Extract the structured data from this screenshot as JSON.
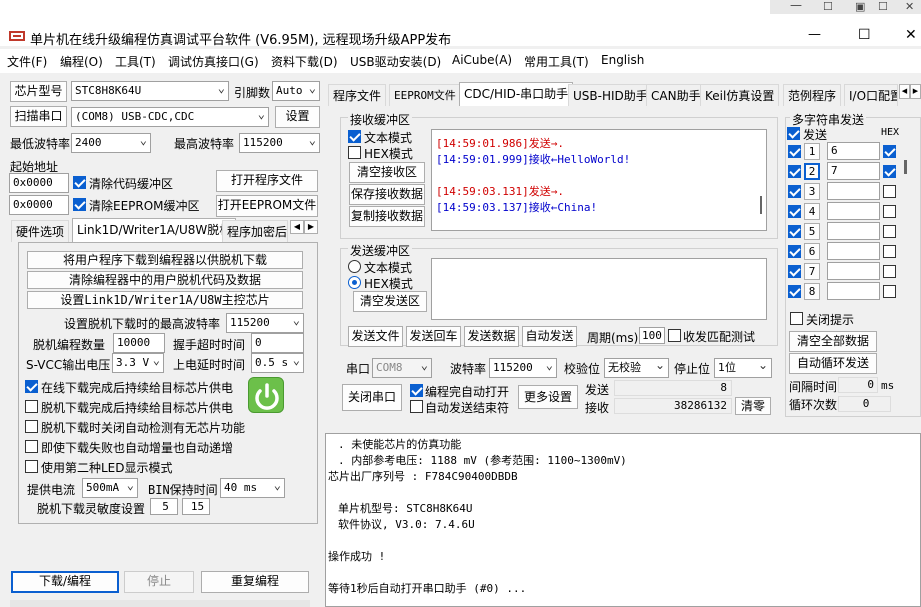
{
  "title": "单片机在线升级编程仿真调试平台软件 (V6.95M), 远程现场升级APP发布",
  "window_controls": {
    "min": "—",
    "max": "☐",
    "close": "✕"
  },
  "menu": [
    "文件(F)",
    "编程(O)",
    "工具(T)",
    "调试仿真接口(G)",
    "资料下载(D)",
    "USB驱动安装(D)",
    "AiCube(A)",
    "常用工具(T)",
    "English"
  ],
  "left": {
    "chip_btn": "芯片型号",
    "chip_val": "STC8H8K64U",
    "pin_label": "引脚数",
    "pin_val": "Auto",
    "scan_btn": "扫描串口",
    "port_val": "(COM8) USB-CDC,CDC",
    "settings_btn": "设置",
    "minbaud_label": "最低波特率",
    "minbaud_val": "2400",
    "maxbaud_label": "最高波特率",
    "maxbaud_val": "115200",
    "start_label": "起始地址",
    "addr1": "0x0000",
    "clear_code": "清除代码缓冲区",
    "open_prog": "打开程序文件",
    "addr2": "0x0000",
    "clear_eeprom": "清除EEPROM缓冲区",
    "open_eeprom": "打开EEPROM文件",
    "tabs": [
      "硬件选项",
      "Link1D/Writer1A/U8W脱机",
      "程序加密后"
    ],
    "panel": {
      "btn1": "将用户程序下载到编程器以供脱机下载",
      "btn2": "清除编程器中的用户脱机代码及数据",
      "btn3": "设置Link1D/Writer1A/U8W主控芯片",
      "maxbaud_label": "设置脱机下载时的最高波特率",
      "maxbaud_val": "115200",
      "count_label": "脱机编程数量",
      "count_val": "10000",
      "timeout_label": "握手超时时间",
      "timeout_val": "0",
      "svcc_label": "S-VCC输出电压",
      "svcc_val": "3.3 V",
      "delay_label": "上电延时时间",
      "delay_val": "0.5 s",
      "checks": [
        "在线下载完成后持续给目标芯片供电",
        "脱机下载完成后持续给目标芯片供电",
        "脱机下载时关闭自动检测有无芯片功能",
        "即使下载失败也自动增量也自动递增",
        "使用第二种LED显示模式"
      ],
      "checks_on": [
        true,
        false,
        false,
        false,
        false
      ],
      "current_label": "提供电流",
      "current_val": "500mA",
      "bin_label": "BIN保持时间",
      "bin_val": "40 ms",
      "sens_label": "脱机下载灵敏度设置",
      "sens1": "5",
      "sens2": "15"
    },
    "download_btn": "下载/编程",
    "stop_btn": "停止",
    "reprog_btn": "重复编程"
  },
  "right_tabs": [
    "程序文件",
    "EEPROM文件",
    "CDC/HID-串口助手",
    "USB-HID助手",
    "CAN助手",
    "Keil仿真设置",
    "范例程序",
    "I/O口配置"
  ],
  "recv": {
    "title": "接收缓冲区",
    "text_mode": "文本模式",
    "hex_mode": "HEX模式",
    "clear": "清空接收区",
    "save": "保存接收数据",
    "copy": "复制接收数据",
    "lines": [
      {
        "ts": "[14:59:01.986]",
        "dir": "发送→",
        "msg": ".",
        "color": "#d00000"
      },
      {
        "ts": "[14:59:01.999]",
        "dir": "接收←",
        "msg": "HelloWorld!",
        "color": "#0000cc"
      },
      {
        "ts": "[14:59:03.131]",
        "dir": "发送→",
        "msg": ".",
        "color": "#d00000"
      },
      {
        "ts": "[14:59:03.137]",
        "dir": "接收←",
        "msg": "China!",
        "color": "#0000cc"
      }
    ]
  },
  "send": {
    "title": "发送缓冲区",
    "text_mode": "文本模式",
    "hex_mode": "HEX模式",
    "clear": "清空发送区",
    "send_file": "发送文件",
    "send_enter": "发送回车",
    "send_data": "发送数据",
    "auto_send": "自动发送",
    "period_label": "周期(ms)",
    "period_val": "100",
    "match_label": "收发匹配测试"
  },
  "serial": {
    "port_label": "串口",
    "port_val": "COM8",
    "baud_label": "波特率",
    "baud_val": "115200",
    "parity_label": "校验位",
    "parity_val": "无校验",
    "stop_label": "停止位",
    "stop_val": "1位",
    "close_btn": "关闭串口",
    "auto_open": "编程完自动打开",
    "auto_end": "自动发送结束符",
    "more_btn": "更多设置",
    "sent_label": "发送",
    "sent_val": "8",
    "recv_label": "接收",
    "recv_val": "38286132",
    "clear_btn": "清零"
  },
  "multi": {
    "title": "多字符串发送",
    "send_col": "发送",
    "hex_col": "HEX",
    "rows": [
      {
        "n": "1",
        "val": "6",
        "hex": true
      },
      {
        "n": "2",
        "val": "7",
        "hex": true
      },
      {
        "n": "3",
        "val": "",
        "hex": false
      },
      {
        "n": "4",
        "val": "",
        "hex": false
      },
      {
        "n": "5",
        "val": "",
        "hex": false
      },
      {
        "n": "6",
        "val": "",
        "hex": false
      },
      {
        "n": "7",
        "val": "",
        "hex": false
      },
      {
        "n": "8",
        "val": "",
        "hex": false
      }
    ],
    "close_hint": "关闭提示",
    "clear_all": "清空全部数据",
    "auto_loop": "自动循环发送",
    "interval_label": "间隔时间",
    "interval_val": "0",
    "interval_unit": "ms",
    "loop_label": "循环次数",
    "loop_val": "0"
  },
  "log": [
    ". 未使能芯片的仿真功能",
    ". 内部参考电压: 1188 mV (参考范围: 1100~1300mV)",
    "芯片出厂序列号 : F784C90400DBDB",
    "",
    "单片机型号: STC8H8K64U",
    "软件协议, V3.0: 7.4.6U",
    "",
    "操作成功 !",
    "",
    "等待1秒后自动打开串口助手 (#0) ..."
  ]
}
